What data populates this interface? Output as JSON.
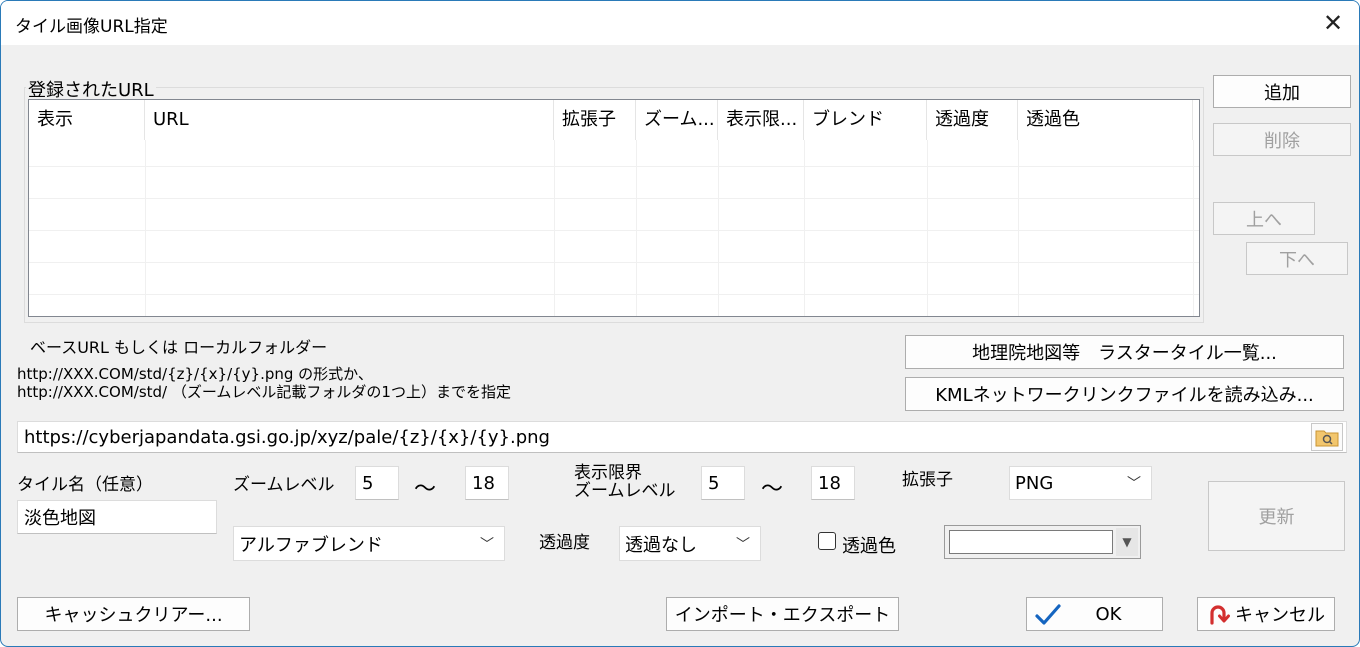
{
  "window": {
    "title": "タイル画像URL指定",
    "close": "✕"
  },
  "group": {
    "label": "登録されたURL"
  },
  "table": {
    "columns": [
      "表示",
      "URL",
      "拡張子",
      "ズーム...",
      "表示限...",
      "ブレンド",
      "透過度",
      "透過色"
    ],
    "rows": []
  },
  "side_buttons": {
    "add": "追加",
    "delete": "削除",
    "up": "上へ",
    "down": "下へ"
  },
  "base_url": {
    "label": "ベースURL  もしくは  ローカルフォルダー",
    "hint_line1": "http://XXX.COM/std/{z}/{x}/{y}.png の形式か、",
    "hint_line2": "http://XXX.COM/std/  （ズームレベル記載フォルダの1つ上）までを指定",
    "value": "https://cyberjapandata.gsi.go.jp/xyz/pale/{z}/{x}/{y}.png"
  },
  "right_buttons": {
    "raster_list": "地理院地図等　ラスタータイル一覧...",
    "kml": "KMLネットワークリンクファイルを読み込み..."
  },
  "tile_name": {
    "label": "タイル名（任意）",
    "value": "淡色地図"
  },
  "zoom": {
    "label": "ズームレベル",
    "min": "5",
    "tilde": "〜",
    "max": "18"
  },
  "display_zoom": {
    "label_line1": "表示限界",
    "label_line2": "ズームレベル",
    "min": "5",
    "tilde": "〜",
    "max": "18"
  },
  "extension": {
    "label": "拡張子",
    "value": "PNG"
  },
  "blend": {
    "value": "アルファブレンド"
  },
  "transparency": {
    "label": "透過度",
    "value": "透過なし"
  },
  "trans_color": {
    "label": "透過色",
    "checked": false
  },
  "update_button": "更新",
  "bottom": {
    "cache_clear": "キャッシュクリアー...",
    "import_export": "インポート・エクスポート",
    "ok": "OK",
    "cancel": "キャンセル"
  },
  "colors": {
    "ok_check": "#1565c0",
    "cancel_icon": "#d32f2f",
    "folder": "#e8b24a",
    "border_accent": "#2a7ab8"
  }
}
